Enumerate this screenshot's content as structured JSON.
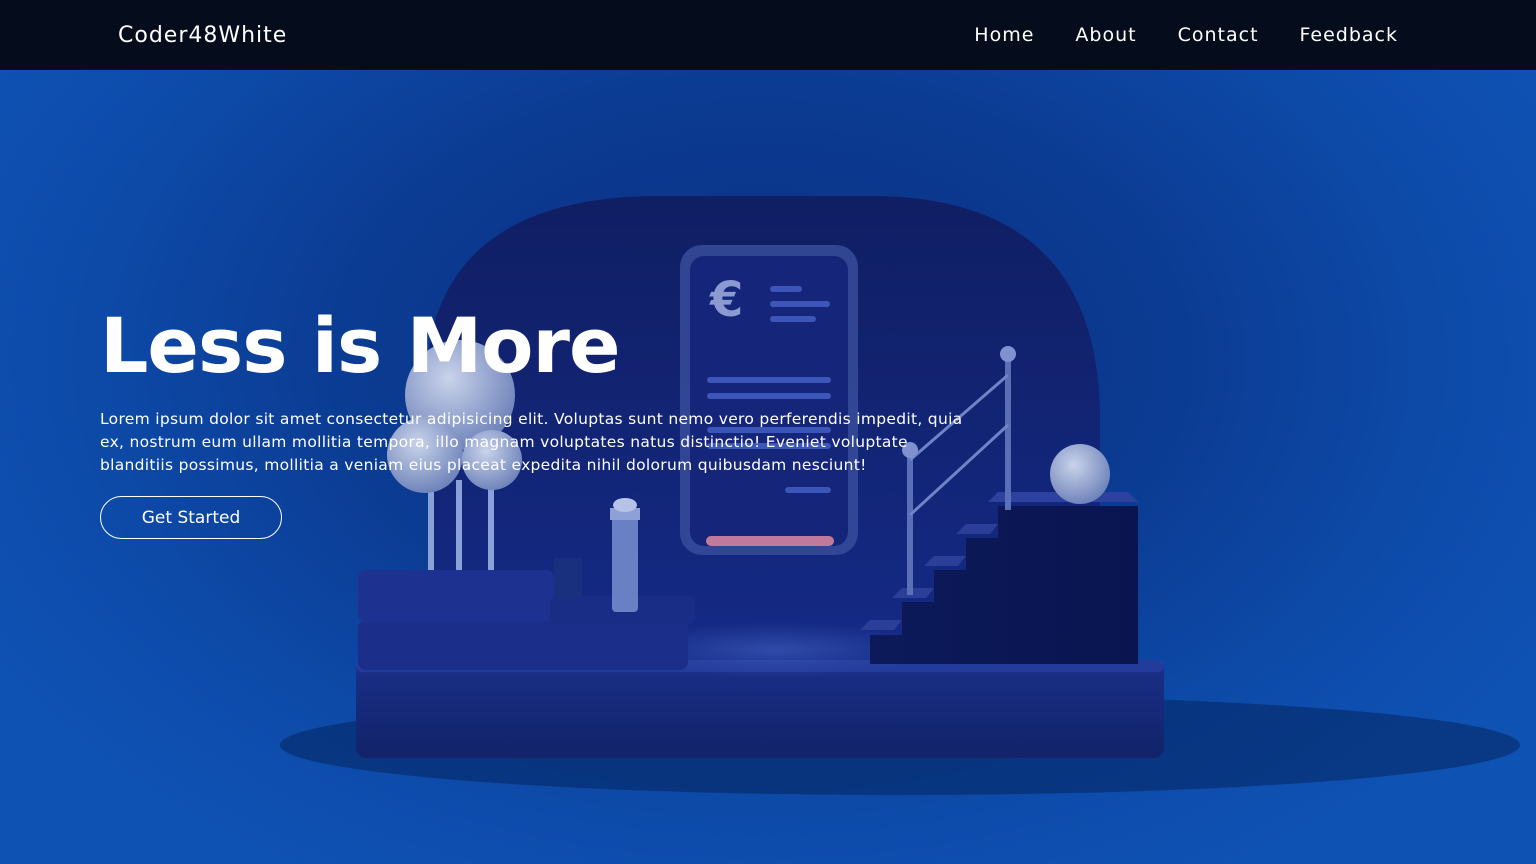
{
  "navbar": {
    "brand": "Coder48White",
    "links": [
      "Home",
      "About",
      "Contact",
      "Feedback"
    ]
  },
  "hero": {
    "title": "Less is More",
    "description": "Lorem ipsum dolor sit amet consectetur adipisicing elit. Voluptas sunt nemo vero perferendis impedit, quia ex, nostrum eum ullam mollitia tempora, illo magnam voluptates natus distinctio! Eveniet voluptate blanditiis possimus, mollitia a veniam eius placeat expedita nihil dolorum quibusdam nesciunt!",
    "cta_label": "Get Started"
  },
  "illustration": {
    "phone_currency_symbol": "€",
    "icons": [
      "euro-icon",
      "tree-icon",
      "lighthouse-icon",
      "stairs-icon",
      "sphere-icon"
    ]
  },
  "colors": {
    "navbar_bg": "#050d1c",
    "page_bg": "#0b3b92",
    "text": "#ffffff",
    "phone_accent": "#c07a9c"
  }
}
